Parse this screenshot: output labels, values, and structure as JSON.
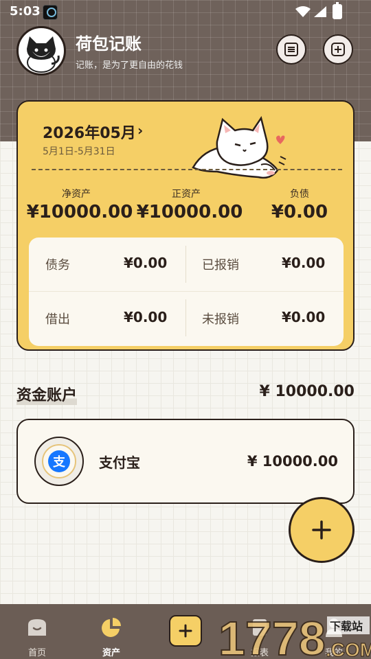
{
  "status_bar": {
    "time": "5:03"
  },
  "header": {
    "title": "荷包记账",
    "subtitle": "记账，是为了更自由的花钱"
  },
  "summary": {
    "period_title": "2026年05月",
    "period_range": "5月1日-5月31日",
    "net_assets_label": "净资产",
    "net_assets_value": "¥10000.00",
    "positive_assets_label": "正资产",
    "positive_assets_value": "¥10000.00",
    "liabilities_label": "负债",
    "liabilities_value": "¥0.00",
    "debt_label": "债务",
    "debt_value": "¥0.00",
    "reimbursed_label": "已报销",
    "reimbursed_value": "¥0.00",
    "lent_label": "借出",
    "lent_value": "¥0.00",
    "unreimbursed_label": "未报销",
    "unreimbursed_value": "¥0.00"
  },
  "accounts": {
    "section_title": "资金账户",
    "section_total": "¥ 10000.00",
    "items": [
      {
        "name": "支付宝",
        "balance": "¥ 10000.00",
        "icon": "alipay-icon",
        "icon_glyph": "支",
        "icon_color": "#1677ff"
      }
    ]
  },
  "bottom_nav": {
    "items": [
      {
        "label": "首页",
        "icon": "home-icon"
      },
      {
        "label": "资产",
        "icon": "pie-chart-icon",
        "active": true
      },
      {
        "label": "报表",
        "icon": "report-icon"
      },
      {
        "label": "我的",
        "icon": "profile-icon"
      }
    ]
  },
  "watermark": {
    "text": "1778",
    "suffix": "下载站",
    "domain": ".COM"
  },
  "colors": {
    "accent_yellow": "#f5cf66",
    "header_brown": "#6f625b",
    "nav_brown": "#6b5d55",
    "ink": "#2a1f1a",
    "alipay_blue": "#1677ff"
  }
}
